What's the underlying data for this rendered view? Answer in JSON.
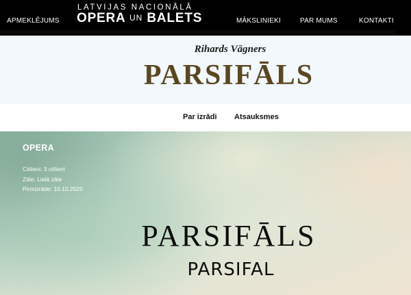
{
  "header": {
    "nav_left": [
      "APMEKLĒJUMS"
    ],
    "logo": {
      "line1": "LATVIJAS NACIONĀLĀ",
      "line2_a": "OPERA",
      "line2_b": "UN",
      "line2_c": "BALETS"
    },
    "nav_right": [
      "MĀKSLINIEKI",
      "PAR MUMS",
      "KONTAKTI"
    ]
  },
  "title_band": {
    "composer": "Rihards Vāgners",
    "title": "PARSIFĀLS"
  },
  "tabs": [
    "Par izrādi",
    "Atsauksmes"
  ],
  "hero": {
    "category": "OPERA",
    "meta": [
      "Cēlieni: 3 cēlieni",
      "Zāle: Lielā zāle",
      "Pirmizrāde: 10.10.2025"
    ],
    "title_lv": "PARSIFĀLS",
    "title_en": "PARSIFAL"
  },
  "colors": {
    "topbar": "#000000",
    "title_band_bg": "#f2f8fb",
    "title_color": "#5a4722",
    "hero_text": "#ffffff"
  }
}
